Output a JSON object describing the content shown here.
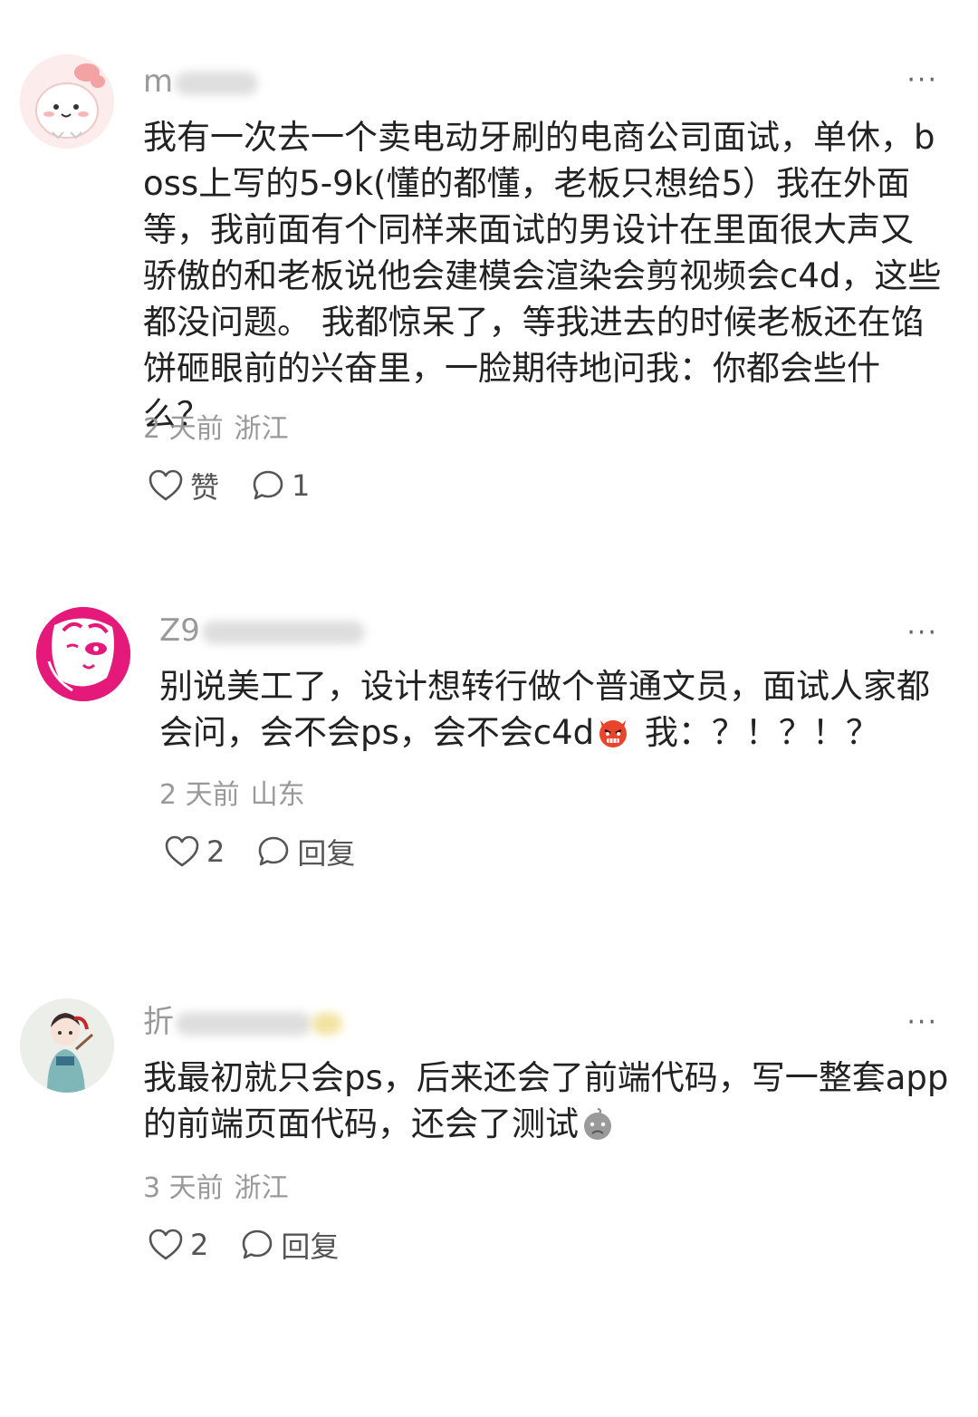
{
  "comments": [
    {
      "username_prefix": "m",
      "body": "我有一次去一个卖电动牙刷的电商公司面试，单休，boss上写的5-9k(懂的都懂，老板只想给5）我在外面等，我前面有个同样来面试的男设计在里面很大声又骄傲的和老板说他会建模会渲染会剪视频会c4d，这些都没问题。 我都惊呆了，等我进去的时候老板还在馅饼砸眼前的兴奋里，一脸期待地问我：你都会些什么？",
      "time": "2 天前",
      "location": "浙江",
      "like_label": "赞",
      "reply_label": "1",
      "more_label": "···",
      "avatar_icon": "pink-bunny-avatar"
    },
    {
      "username_prefix": "Z9",
      "body_part1": "别说美工了，设计想转行做个普通文员，面试人家都会问，会不会ps，会不会c4d",
      "emoji_icon": "angry-devil-emoji",
      "body_part2": " 我：？！？！？",
      "time": "2 天前",
      "location": "山东",
      "like_label": "2",
      "reply_label": "回复",
      "more_label": "···",
      "avatar_icon": "magenta-mask-avatar"
    },
    {
      "username_prefix": "折",
      "body_part1": "我最初就只会ps，后来还会了前端代码，写一整套app的前端页面代码，还会了测试",
      "emoji_icon": "gray-sad-emoji",
      "time": "3 天前",
      "location": "浙江",
      "like_label": "2",
      "reply_label": "回复",
      "more_label": "···",
      "avatar_icon": "hanfu-girl-avatar"
    }
  ]
}
